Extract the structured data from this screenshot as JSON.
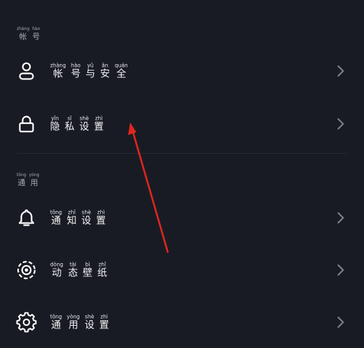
{
  "sections": [
    {
      "header": {
        "chars": [
          {
            "py": "zhàng",
            "hz": "帐"
          },
          {
            "py": "hào",
            "hz": "号"
          }
        ]
      },
      "items": [
        {
          "icon": "person-icon",
          "chars": [
            {
              "py": "zhàng",
              "hz": "帐"
            },
            {
              "py": "hào",
              "hz": "号"
            },
            {
              "py": "yǔ",
              "hz": "与"
            },
            {
              "py": "ān",
              "hz": "安"
            },
            {
              "py": "quán",
              "hz": "全"
            }
          ]
        },
        {
          "icon": "lock-icon",
          "chars": [
            {
              "py": "yǐn",
              "hz": "隐"
            },
            {
              "py": "sī",
              "hz": "私"
            },
            {
              "py": "shè",
              "hz": "设"
            },
            {
              "py": "zhì",
              "hz": "置"
            }
          ]
        }
      ]
    },
    {
      "header": {
        "chars": [
          {
            "py": "tōng",
            "hz": "通"
          },
          {
            "py": "yòng",
            "hz": "用"
          }
        ]
      },
      "items": [
        {
          "icon": "bell-icon",
          "chars": [
            {
              "py": "tōng",
              "hz": "通"
            },
            {
              "py": "zhī",
              "hz": "知"
            },
            {
              "py": "shè",
              "hz": "设"
            },
            {
              "py": "zhì",
              "hz": "置"
            }
          ]
        },
        {
          "icon": "dynamic-wallpaper-icon",
          "chars": [
            {
              "py": "dòng",
              "hz": "动"
            },
            {
              "py": "tài",
              "hz": "态"
            },
            {
              "py": "bì",
              "hz": "壁"
            },
            {
              "py": "zhǐ",
              "hz": "纸"
            }
          ]
        },
        {
          "icon": "gear-icon",
          "chars": [
            {
              "py": "tōng",
              "hz": "通"
            },
            {
              "py": "yòng",
              "hz": "用"
            },
            {
              "py": "shè",
              "hz": "设"
            },
            {
              "py": "zhì",
              "hz": "置"
            }
          ]
        }
      ]
    }
  ],
  "colors": {
    "background": "#191b24",
    "text": "#f2f2f4",
    "chevron": "#7d7f88",
    "divider": "#262833",
    "annotation_arrow": "#e0261e"
  }
}
